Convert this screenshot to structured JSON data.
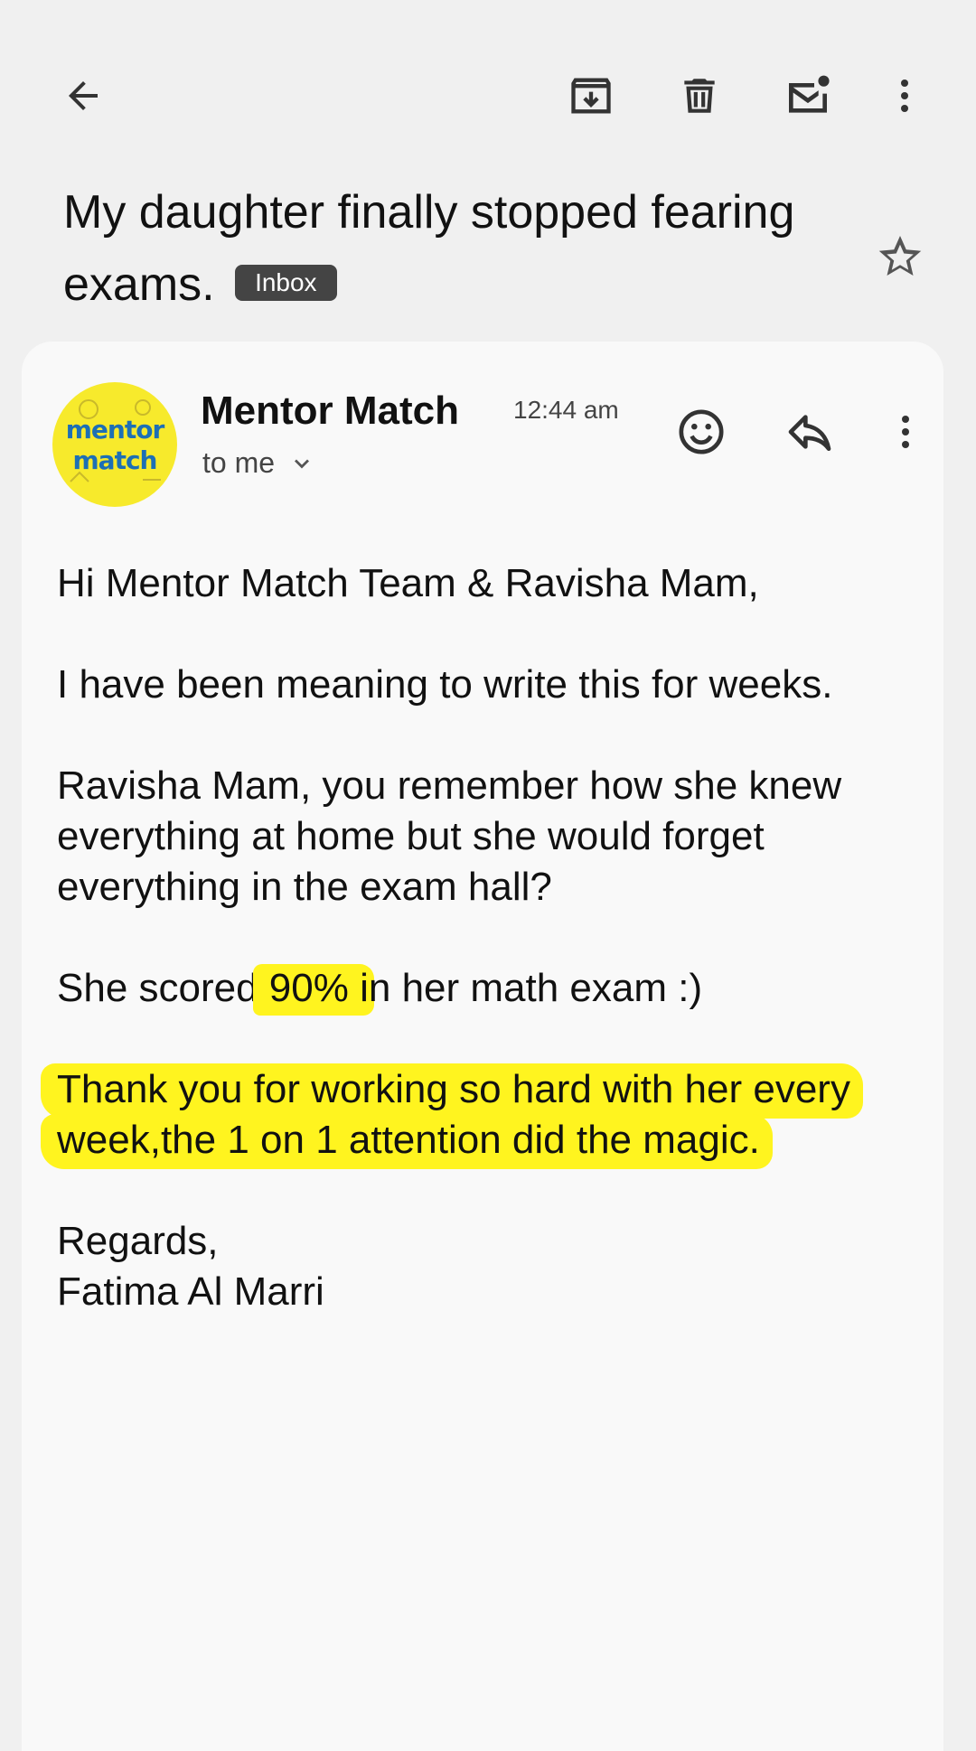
{
  "subject": {
    "title": "My daughter finally stopped fearing exams.",
    "label_badge": "Inbox"
  },
  "toolbar": {
    "icons": [
      "back-arrow-icon",
      "archive-icon",
      "trash-icon",
      "mark-unread-icon",
      "more-vert-icon"
    ]
  },
  "message": {
    "sender_name": "Mentor Match",
    "time": "12:44 am",
    "recipient": "to me",
    "avatar_text_line1": "mentor",
    "avatar_text_line2": "match",
    "body": {
      "greeting": "Hi Mentor Match Team & Ravisha Mam,",
      "p1": "I have been meaning to write this for weeks.",
      "p2": "Ravisha Mam, you remember how she knew everything at home but she would forget everything in the exam hall?",
      "p3_before": "She scored",
      "p3_highlight": " 90% i",
      "p3_after": "n her math exam :)",
      "p4": "Thank you for working so hard with her every week,the 1 on 1 attention did the magic.",
      "signoff": "Regards,",
      "signature": "Fatima Al Marri"
    }
  },
  "colors": {
    "highlight": "#fff41f",
    "avatar_bg": "#f7ea2c",
    "avatar_text": "#1d6fb5",
    "badge_bg": "#444444"
  }
}
